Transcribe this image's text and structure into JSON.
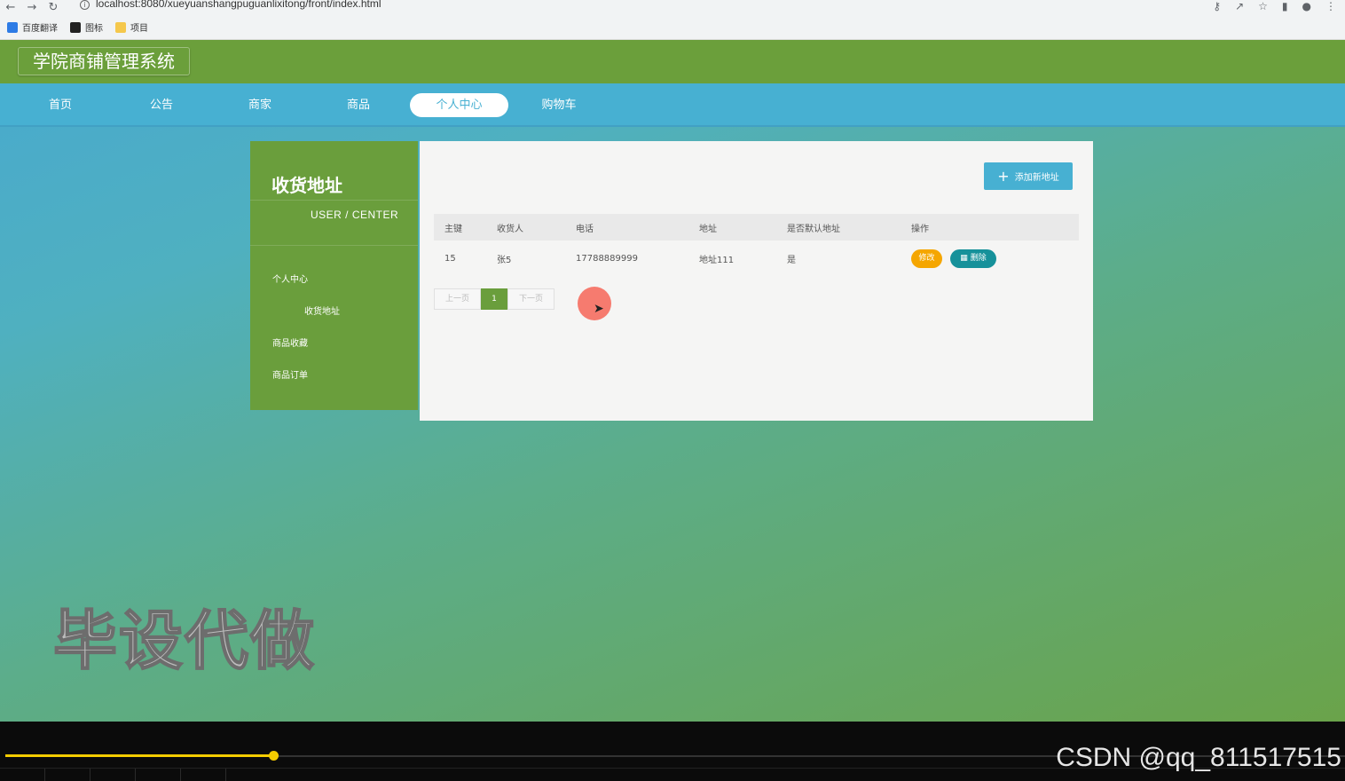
{
  "browser": {
    "url": "localhost:8080/xueyuanshangpuguanlixitong/front/index.html",
    "bookmarks": [
      "百度翻译",
      "图标",
      "项目"
    ]
  },
  "app": {
    "title": "学院商铺管理系统",
    "nav": [
      "首页",
      "公告",
      "商家",
      "商品",
      "个人中心",
      "购物车"
    ],
    "active_nav": "个人中心"
  },
  "sidebar": {
    "title": "收货地址",
    "subtitle": "USER / CENTER",
    "items": [
      "个人中心",
      "收货地址",
      "商品收藏",
      "商品订单"
    ]
  },
  "panel": {
    "add_button": "添加新地址",
    "columns": [
      "主键",
      "收货人",
      "电话",
      "地址",
      "是否默认地址",
      "操作"
    ],
    "rows": [
      {
        "id": "15",
        "receiver": "张5",
        "phone": "17788889999",
        "address": "地址111",
        "is_default": "是"
      }
    ],
    "edit_label": "修改",
    "delete_label": "删除",
    "pager": {
      "prev": "上一页",
      "current": "1",
      "next": "下一页"
    }
  },
  "overlay": {
    "watermark": "毕设代做",
    "credit": "CSDN @qq_811517515",
    "video_progress": 0.2
  },
  "colors": {
    "header_green": "#6b9f3b",
    "nav_blue": "#47b0d2",
    "edit_orange": "#f5a600",
    "delete_teal": "#16919a"
  }
}
